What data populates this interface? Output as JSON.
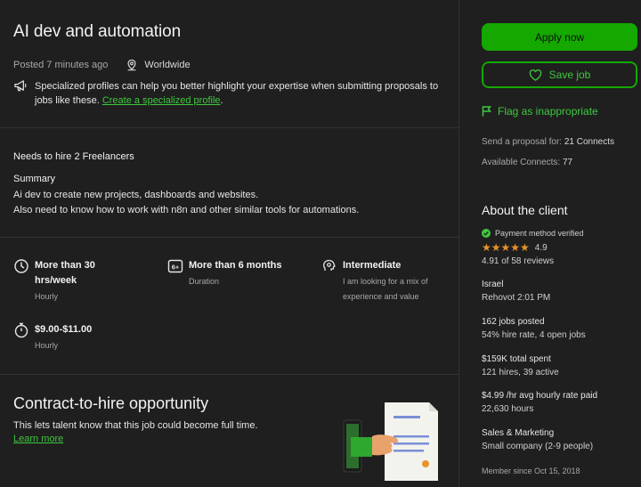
{
  "job": {
    "title": "AI dev and automation",
    "posted": "Posted 7 minutes ago",
    "location": "Worldwide",
    "notice_text": "Specialized profiles can help you better highlight your expertise when submitting proposals to jobs like these.",
    "notice_link": "Create a specialized profile",
    "notice_end": ".",
    "needs": "Needs to hire 2 Freelancers",
    "summary_heading": "Summary",
    "summary_line1": "Ai dev to create new projects, dashboards and websites.",
    "summary_line2": "Also need to know how to work with n8n and other similar tools for automations."
  },
  "features": {
    "hours": {
      "value_line1": "More than 30",
      "value_line2": "hrs/week",
      "desc": "Hourly"
    },
    "duration": {
      "value": "More than 6 months",
      "desc": "Duration"
    },
    "level": {
      "value": "Intermediate",
      "desc_line1": "I am looking for a mix of",
      "desc_line2": "experience and value"
    },
    "rate": {
      "value": "$9.00-$11.00",
      "desc": "Hourly"
    }
  },
  "contract": {
    "heading": "Contract-to-hire opportunity",
    "text": "This lets talent know that this job could become full time.",
    "link": "Learn more"
  },
  "sidebar": {
    "apply": "Apply now",
    "save": "Save job",
    "flag": "Flag as inappropriate",
    "proposal_label": "Send a proposal for:",
    "proposal_value": "21 Connects",
    "available_label": "Available Connects:",
    "available_value": "77"
  },
  "client": {
    "heading": "About the client",
    "payment": "Payment method verified",
    "rating": "4.9",
    "reviews": "4.91 of 58 reviews",
    "country": "Israel",
    "city_time": "Rehovot 2:01 PM",
    "jobs_posted": "162 jobs posted",
    "hire_rate": "54% hire rate, 4 open jobs",
    "spent": "$159K total spent",
    "hires": "121 hires, 39 active",
    "avg_rate": "$4.99 /hr avg hourly rate paid",
    "hours": "22,630 hours",
    "industry": "Sales & Marketing",
    "company_size": "Small company (2-9 people)",
    "member_since": "Member since Oct 15, 2018"
  },
  "colors": {
    "accent": "#14a800",
    "link": "#3fc83f",
    "star": "#e8932b",
    "bg": "#1f1f1f"
  }
}
